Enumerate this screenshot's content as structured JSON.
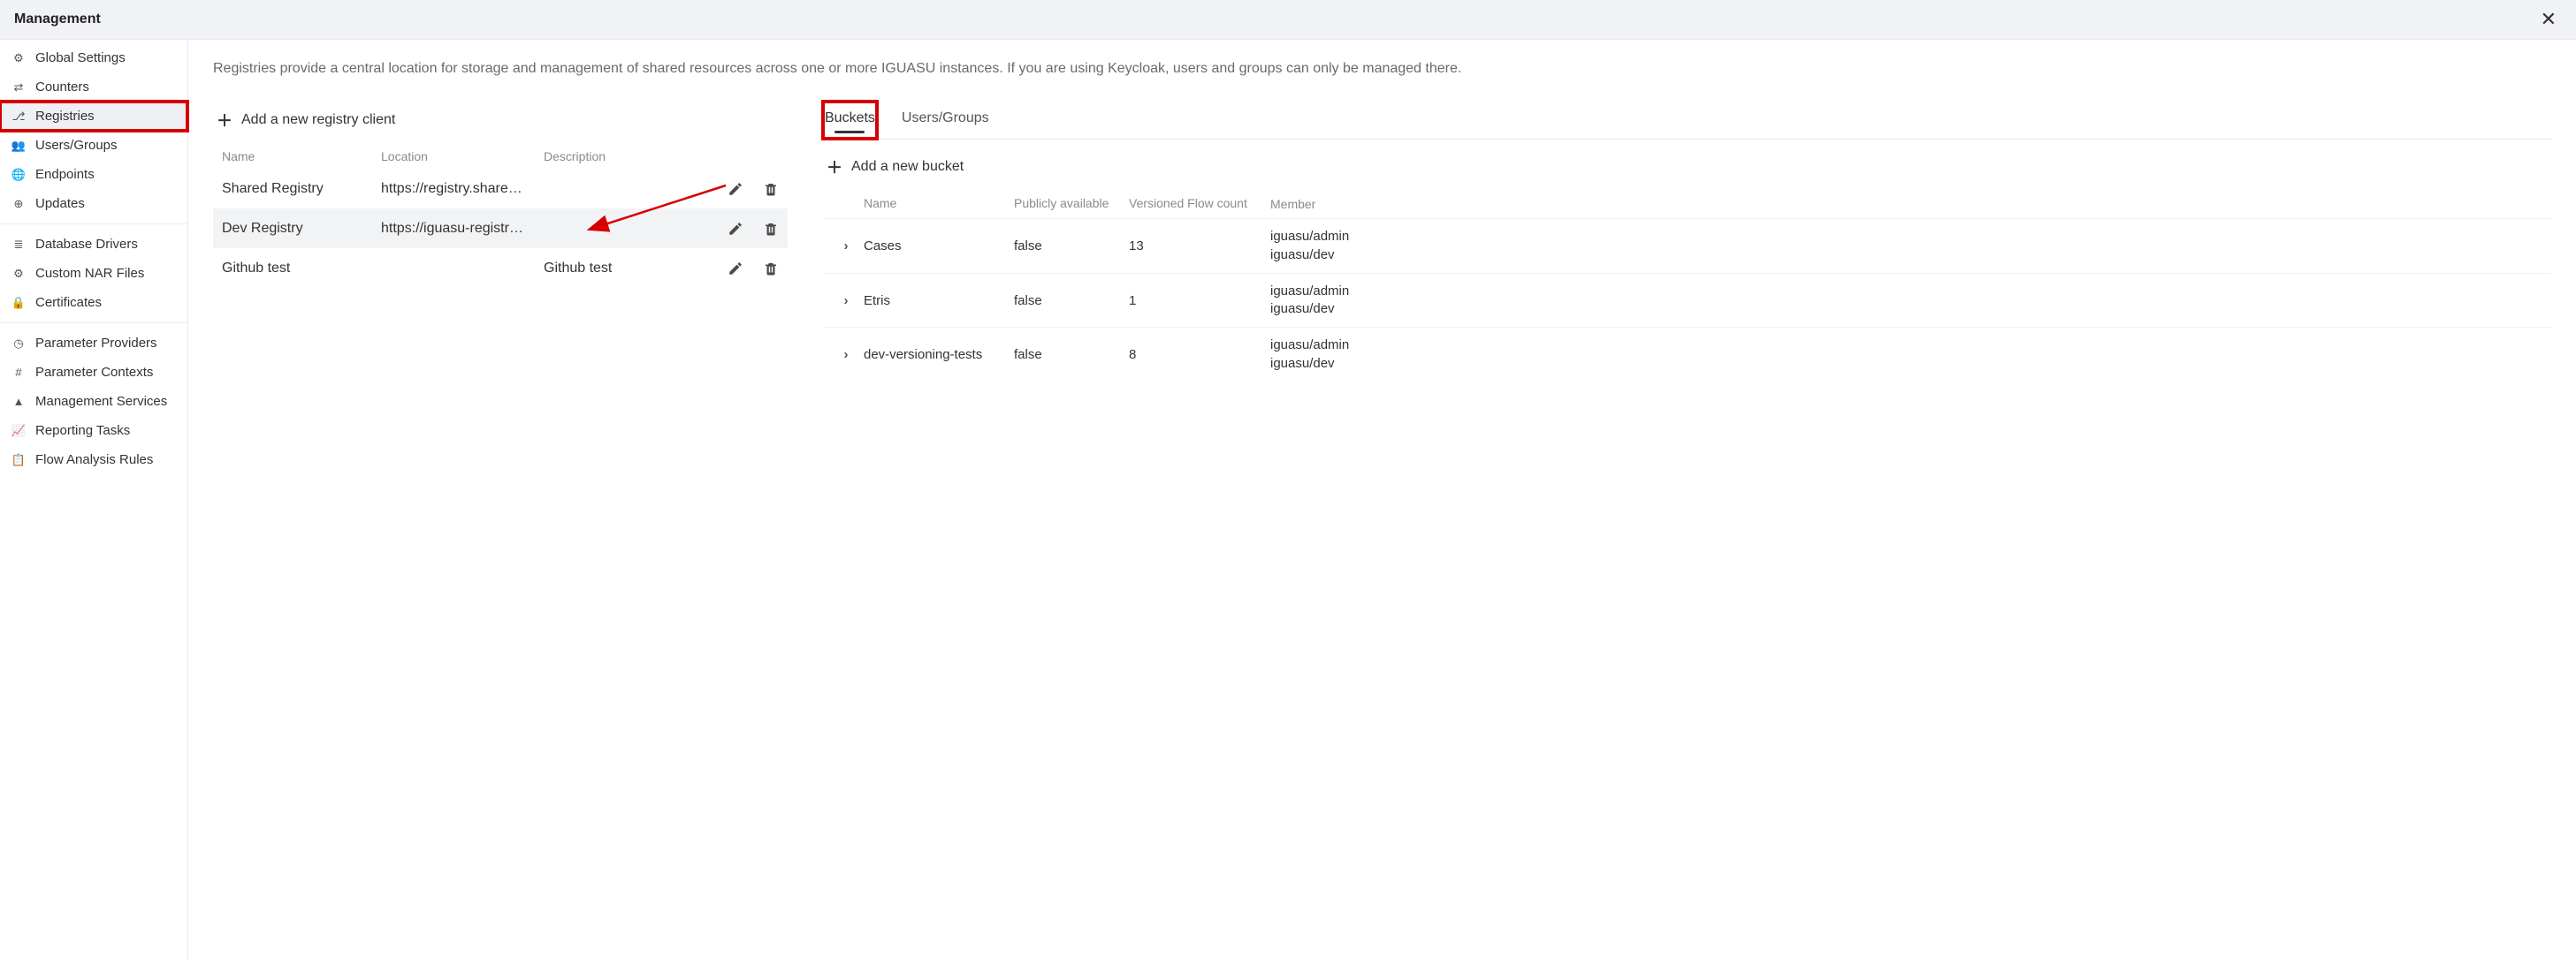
{
  "header": {
    "title": "Management"
  },
  "sidebar": {
    "items": [
      {
        "label": "Global Settings",
        "icon": "sliders"
      },
      {
        "label": "Counters",
        "icon": "arrows"
      },
      {
        "label": "Registries",
        "icon": "branch",
        "active": true,
        "highlight": true
      },
      {
        "label": "Users/Groups",
        "icon": "users"
      },
      {
        "label": "Endpoints",
        "icon": "globe"
      },
      {
        "label": "Updates",
        "icon": "circle-plus"
      }
    ],
    "items2": [
      {
        "label": "Database Drivers",
        "icon": "db"
      },
      {
        "label": "Custom NAR Files",
        "icon": "puzzle"
      },
      {
        "label": "Certificates",
        "icon": "lock"
      }
    ],
    "items3": [
      {
        "label": "Parameter Providers",
        "icon": "clock"
      },
      {
        "label": "Parameter Contexts",
        "icon": "hash"
      },
      {
        "label": "Management Services",
        "icon": "tray"
      },
      {
        "label": "Reporting Tasks",
        "icon": "chart"
      },
      {
        "label": "Flow Analysis Rules",
        "icon": "clipboard"
      }
    ]
  },
  "intro": "Registries provide a central location for storage and management of shared resources across one or more IGUASU instances. If you are using Keycloak, users and groups can only be managed there.",
  "registries": {
    "add_label": "Add a new registry client",
    "columns": {
      "name": "Name",
      "location": "Location",
      "description": "Description"
    },
    "rows": [
      {
        "name": "Shared Registry",
        "location": "https://registry.share…",
        "description": ""
      },
      {
        "name": "Dev Registry",
        "location": "https://iguasu-registr…",
        "description": "",
        "selected": true
      },
      {
        "name": "Github test",
        "location": "",
        "description": "Github test"
      }
    ]
  },
  "tabs": {
    "buckets": "Buckets",
    "users": "Users/Groups",
    "active": "buckets"
  },
  "buckets": {
    "add_label": "Add a new bucket",
    "columns": {
      "name": "Name",
      "pub": "Publicly available",
      "count": "Versioned Flow count",
      "member": "Member"
    },
    "rows": [
      {
        "name": "Cases",
        "pub": "false",
        "count": "13",
        "member": "iguasu/admin\niguasu/dev"
      },
      {
        "name": "Etris",
        "pub": "false",
        "count": "1",
        "member": "iguasu/admin\niguasu/dev"
      },
      {
        "name": "dev-versioning-tests",
        "pub": "false",
        "count": "8",
        "member": "iguasu/admin\niguasu/dev"
      }
    ]
  }
}
